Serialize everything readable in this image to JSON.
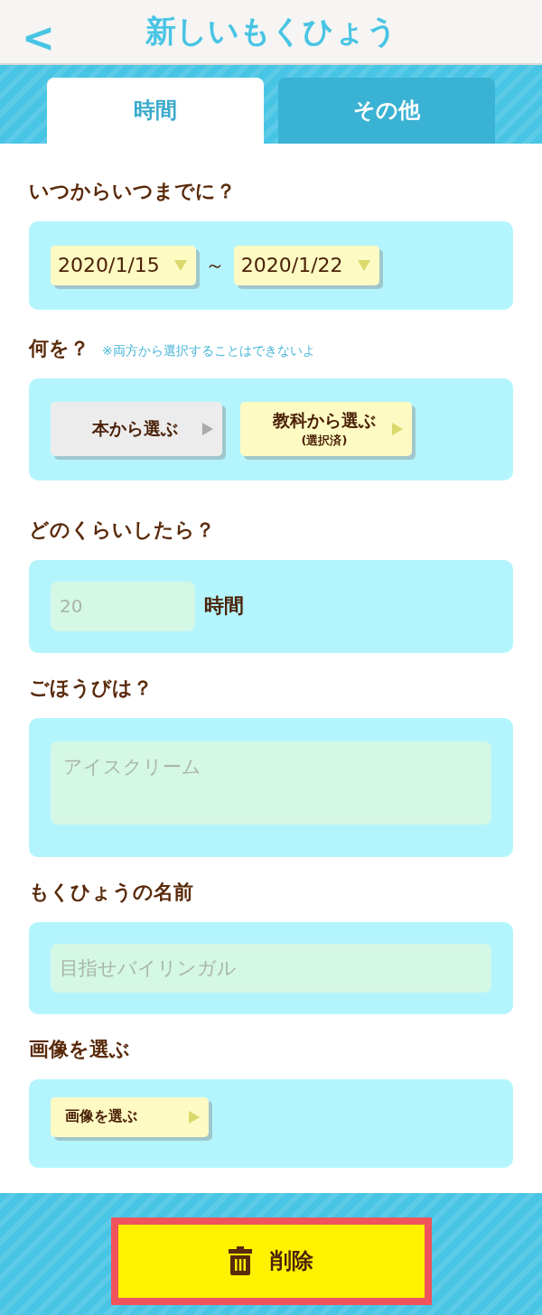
{
  "header": {
    "back": "<",
    "title": "新しいもくひょう"
  },
  "tabs": [
    {
      "label": "時間",
      "selected": true
    },
    {
      "label": "その他",
      "selected": false
    }
  ],
  "period": {
    "label": "いつからいつまでに？",
    "from": "2020/1/15",
    "separator": "～",
    "to": "2020/1/22"
  },
  "target": {
    "label": "何を？",
    "note": "※両方から選択することはできないよ",
    "options": [
      {
        "label": "本から選ぶ",
        "selected": false
      },
      {
        "label": "教科から選ぶ",
        "sub": "(選択済)",
        "selected": true
      }
    ]
  },
  "amount": {
    "label": "どのくらいしたら？",
    "placeholder": "20",
    "unit": "時間"
  },
  "reward": {
    "label": "ごほうびは？",
    "placeholder": "アイスクリーム"
  },
  "name": {
    "label": "もくひょうの名前",
    "placeholder": "目指せバイリンガル"
  },
  "image": {
    "label": "画像を選ぶ",
    "button": "画像を選ぶ"
  },
  "delete_button": {
    "label": "削除"
  }
}
